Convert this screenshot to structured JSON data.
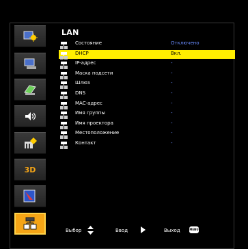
{
  "menu_title": "LAN",
  "rows": [
    {
      "label": "Состояние",
      "value": "Отключено"
    },
    {
      "label": "DHCP",
      "value": "Вкл."
    },
    {
      "label": "IP-адрес",
      "value": "-"
    },
    {
      "label": "Маска подсети",
      "value": "-"
    },
    {
      "label": "Шлюз",
      "value": "-"
    },
    {
      "label": "DNS",
      "value": "-"
    },
    {
      "label": "MAC-адрес",
      "value": "-"
    },
    {
      "label": "Имя группы",
      "value": "-"
    },
    {
      "label": "Имя проектора",
      "value": "-"
    },
    {
      "label": "Местоположение",
      "value": "-"
    },
    {
      "label": "Контакт",
      "value": "-"
    }
  ],
  "sidebar_3d_label": "3D",
  "footer": {
    "select_label": "Выбор",
    "enter_label": "Ввод",
    "exit_label": "Выход",
    "menu_key_label": "MENU"
  },
  "colors": {
    "highlight": "#ffee00",
    "value_text": "#6a8cff",
    "active_tile": "#f5a516"
  }
}
